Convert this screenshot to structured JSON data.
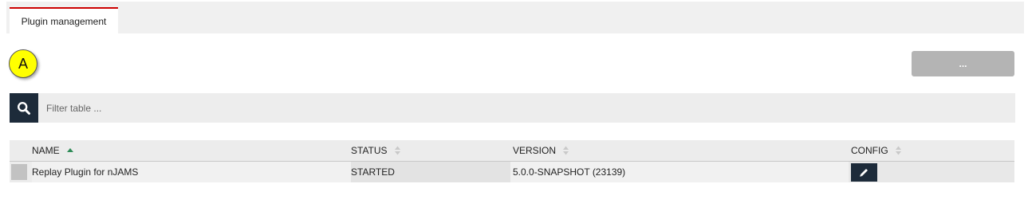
{
  "tabs": [
    {
      "label": "Plugin management",
      "active": true
    }
  ],
  "marker": {
    "label": "A"
  },
  "toolbar": {
    "more_label": "..."
  },
  "filter": {
    "placeholder": "Filter table ..."
  },
  "table": {
    "columns": [
      {
        "label": "NAME",
        "sort": "ascending"
      },
      {
        "label": "STATUS",
        "sort": "none"
      },
      {
        "label": "VERSION",
        "sort": "none"
      },
      {
        "label": "CONFIG",
        "sort": "none"
      }
    ],
    "rows": [
      {
        "name": "Replay Plugin for nJAMS",
        "status": "STARTED",
        "version": "5.0.0-SNAPSHOT (23139)"
      }
    ]
  },
  "colors": {
    "accent": "#cc0000",
    "dark_button": "#1d2b3a",
    "sort_active": "#2e8b57",
    "marker": "#ffff00"
  }
}
